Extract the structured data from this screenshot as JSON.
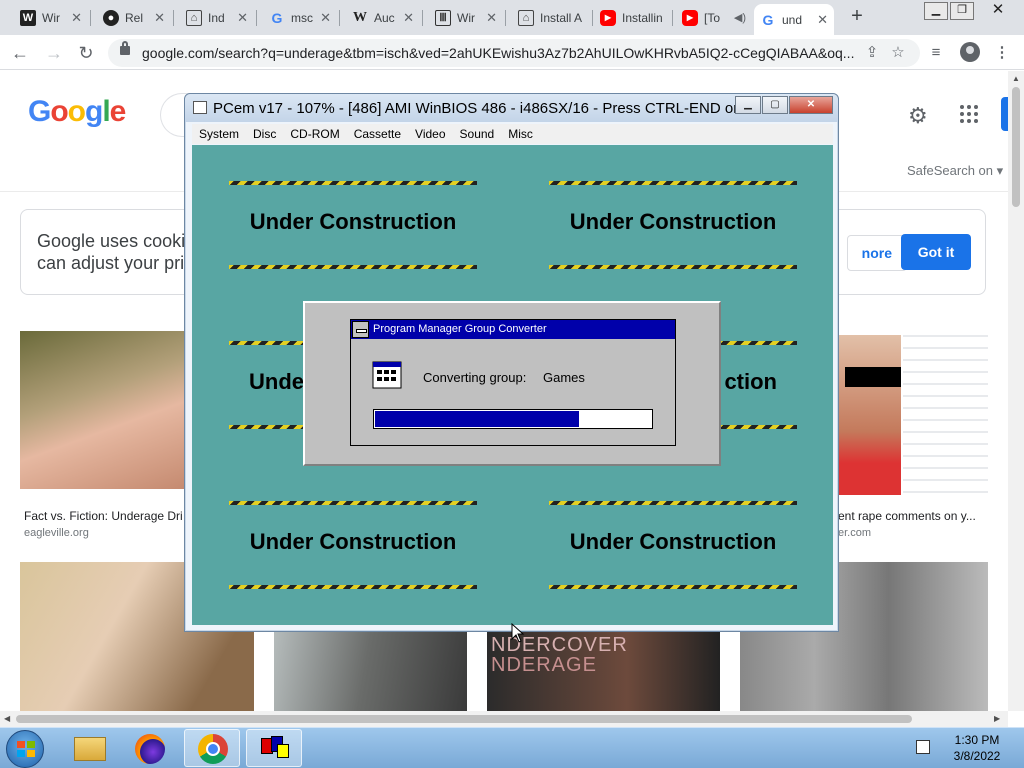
{
  "browser": {
    "tabs": [
      {
        "favicon": "wikipedia-icon",
        "title": "Wir",
        "active": false
      },
      {
        "favicon": "github-icon",
        "title": "Rel",
        "active": false
      },
      {
        "favicon": "archive-icon",
        "title": "Ind",
        "active": false
      },
      {
        "favicon": "google-icon",
        "title": "msc",
        "active": false
      },
      {
        "favicon": "wikipedia-icon",
        "title": "Auc",
        "active": false
      },
      {
        "favicon": "museum-icon",
        "title": "Wir",
        "active": false
      },
      {
        "favicon": "archive-icon",
        "title": "Install A",
        "active": false
      },
      {
        "favicon": "youtube-icon",
        "title": "Installin",
        "active": false
      },
      {
        "favicon": "youtube-icon",
        "title": "[To",
        "active": false,
        "audio": true
      },
      {
        "favicon": "google-icon",
        "title": "und",
        "active": true
      }
    ],
    "new_tab_label": "+",
    "url": "google.com/search?q=underage&tbm=isch&ved=2ahUKEwishu3Az7b2AhUILOwKHRvbA5IQ2-cCegQIABAA&oq..."
  },
  "google": {
    "logo_letters": [
      "G",
      "o",
      "o",
      "g",
      "l",
      "e"
    ],
    "safesearch_label": "SafeSearch on",
    "cookie_text_line1": "Google uses cooki",
    "cookie_text_line2": "can adjust your pri",
    "more_button": "nore",
    "gotit_button": "Got it",
    "results": [
      {
        "caption": "Fact vs. Fiction: Underage Dri",
        "source": "eagleville.org"
      },
      {
        "caption": "ent rape comments on y...",
        "source": "er.com"
      }
    ],
    "thumb4_text_line1": "NDERCOVER",
    "thumb4_text_line2": "NDERAGE"
  },
  "pcem": {
    "title": "PCem v17 - 107% - [486] AMI WinBIOS 486 - i486SX/16 - Press CTRL-END or ...",
    "menu": [
      "System",
      "Disc",
      "CD-ROM",
      "Cassette",
      "Video",
      "Sound",
      "Misc"
    ],
    "banners": [
      {
        "text": "Under Construction"
      },
      {
        "text": "Under Construction"
      },
      {
        "text": "Unde"
      },
      {
        "text": "ction"
      },
      {
        "text": "Under Construction"
      },
      {
        "text": "Under Construction"
      }
    ],
    "dialog": {
      "title": "Program Manager Group Converter",
      "label": "Converting group:",
      "value": "Games",
      "progress": 0.74
    }
  },
  "taskbar": {
    "time": "1:30 PM",
    "date": "3/8/2022",
    "items": [
      "file-explorer-icon",
      "firefox-icon",
      "chrome-icon",
      "pcem-icon"
    ]
  },
  "colors": {
    "dos_teal": "#58a6a3",
    "win31_title_blue": "#0000aa",
    "google_blue": "#1a73e8"
  }
}
